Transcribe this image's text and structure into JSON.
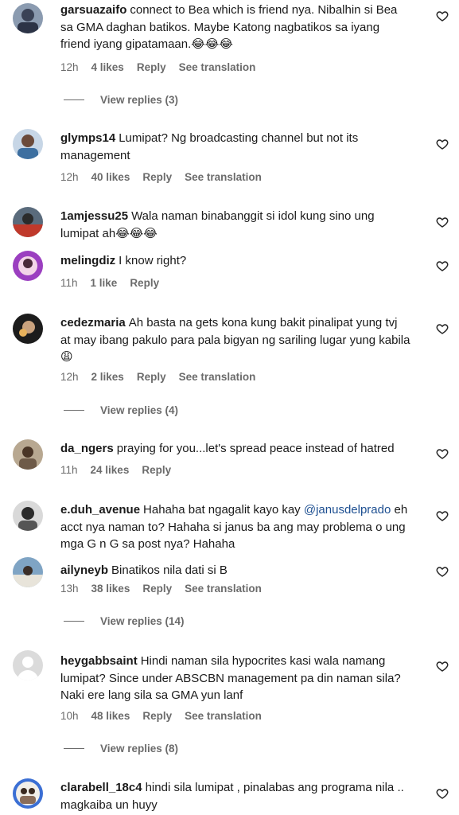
{
  "comments": [
    {
      "username": "garsuazaifo",
      "text": "connect to Bea which is friend nya. Nibalhin si Bea sa GMA daghan batikos. Maybe Katong nagbatikos sa iyang friend iyang gipatamaan.😂😂😂",
      "time": "12h",
      "likes": "4 likes",
      "reply": "Reply",
      "translate": "See translation",
      "view_replies": "View replies (3)"
    },
    {
      "username": "glymps14",
      "text": "Lumipat? Ng broadcasting channel but not its management",
      "time": "12h",
      "likes": "40 likes",
      "reply": "Reply",
      "translate": "See translation"
    },
    {
      "username": "1amjessu25",
      "text": "Wala naman binabanggit si idol kung sino ung lumipat ah😂😂😂"
    },
    {
      "username": "melingdiz",
      "text": "I know right?",
      "time": "11h",
      "likes": "1 like",
      "reply": "Reply"
    },
    {
      "username": "cedezmaria",
      "text": "Ah basta na gets kona kung bakit pinalipat yung tvj at may ibang pakulo para pala bigyan ng sariling lugar yung kabila😩",
      "time": "12h",
      "likes": "2 likes",
      "reply": "Reply",
      "translate": "See translation",
      "view_replies": "View replies (4)"
    },
    {
      "username": "da_ngers",
      "text": "praying for you...let's spread peace instead of hatred",
      "time": "11h",
      "likes": "24 likes",
      "reply": "Reply"
    },
    {
      "username": "e.duh_avenue",
      "text_pre": "Hahaha bat ngagalit kayo kay ",
      "mention": "@janusdelprado",
      "text_post": " eh acct nya naman to? Hahaha si janus ba ang may problema o ung mga G n G sa post nya? Hahaha"
    },
    {
      "username": "ailyneyb",
      "text": "Binatikos nila dati si B",
      "time": "13h",
      "likes": "38 likes",
      "reply": "Reply",
      "translate": "See translation",
      "view_replies": "View replies (14)"
    },
    {
      "username": "heygabbsaint",
      "text": "Hindi naman sila hypocrites kasi wala namang lumipat? Since under ABSCBN management pa din naman sila? Naki ere lang sila sa GMA yun lanf",
      "time": "10h",
      "likes": "48 likes",
      "reply": "Reply",
      "translate": "See translation",
      "view_replies": "View replies (8)"
    },
    {
      "username": "clarabell_18c4",
      "text": "hindi sila lumipat , pinalabas ang programa nila .. magkaiba un huyy"
    }
  ]
}
